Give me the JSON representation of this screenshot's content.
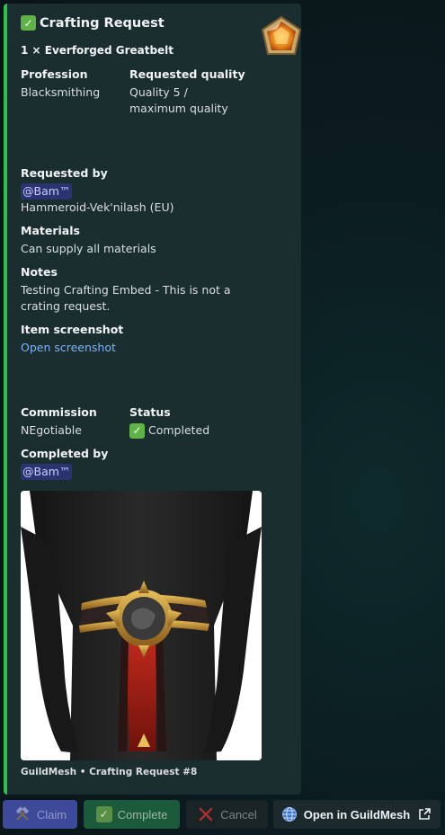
{
  "embed": {
    "title": "Crafting Request",
    "subtitle": "1 × Everforged Greatbelt",
    "accent_color": "#2fbf4f",
    "fields": {
      "profession": {
        "name": "Profession",
        "value": "Blacksmithing"
      },
      "quality": {
        "name": "Requested quality",
        "value_line1": "Quality 5 /",
        "value_line2": "maximum quality"
      },
      "requested_by": {
        "name": "Requested by",
        "mention": "@Bam™",
        "character": "Hammeroid-Vek'nilash (EU)"
      },
      "materials": {
        "name": "Materials",
        "value": "Can supply all materials"
      },
      "notes": {
        "name": "Notes",
        "value_line1": "Testing Crafting Embed - This is not a",
        "value_line2": "crating request."
      },
      "item_screenshot": {
        "name": "Item screenshot",
        "link": "Open screenshot"
      },
      "commission": {
        "name": "Commission",
        "value": "NEgotiable"
      },
      "status": {
        "name": "Status",
        "value": "Completed"
      },
      "completed_by": {
        "name": "Completed by",
        "mention": "@Bam™"
      }
    },
    "footer": "GuildMesh • Crafting Request #8"
  },
  "buttons": {
    "claim": "Claim",
    "complete": "Complete",
    "cancel": "Cancel",
    "open": "Open in GuildMesh"
  },
  "icons": {
    "title": "check-box-icon",
    "thumbnail": "gem-icon",
    "claim": "crossed-hammers-icon",
    "complete": "check-box-icon",
    "cancel": "x-icon",
    "open": "globe-icon",
    "external": "external-link-icon"
  }
}
